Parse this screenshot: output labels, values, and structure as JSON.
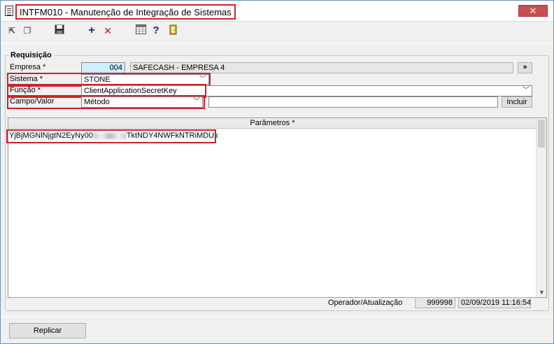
{
  "window": {
    "title": "INTFM010 - Manutenção de Integração de Sistemas",
    "close_label": "✕"
  },
  "toolbar": {
    "buttons": [
      {
        "icon": "first-record-icon"
      },
      {
        "icon": "copy-icon"
      },
      {
        "icon": "save-icon"
      },
      {
        "icon": "add-icon"
      },
      {
        "icon": "delete-icon"
      },
      {
        "icon": "calendar-icon"
      },
      {
        "icon": "help-icon"
      },
      {
        "icon": "exit-icon"
      }
    ]
  },
  "form": {
    "group_label": "Requisição",
    "empresa_label": "Empresa *",
    "empresa_code": "004",
    "empresa_name": "SAFECASH -  EMPRESA 4",
    "more_button": "»",
    "sistema_label": "Sistema *",
    "sistema_value": "STONE",
    "funcao_label": "Função *",
    "funcao_value": "ClientApplicationSecretKey",
    "campo_label": "Campo/Valor",
    "campo_value": "Método",
    "campo_text": "",
    "incluir_button": "Incluir"
  },
  "params": {
    "header": "Parâmetros *",
    "value_prefix": "YjBjMGNlNjgtN2EyNy00",
    "value_suffix": "TktNDY4NWFkNTRiMDUx"
  },
  "footer": {
    "operator_label": "Operador/Atualização",
    "operator_value": "999998",
    "updated_at": "02/09/2019 11:16:54",
    "replicar_button": "Replicar"
  },
  "colors": {
    "highlight": "#d0202a",
    "code_field": "#cdeffd"
  }
}
